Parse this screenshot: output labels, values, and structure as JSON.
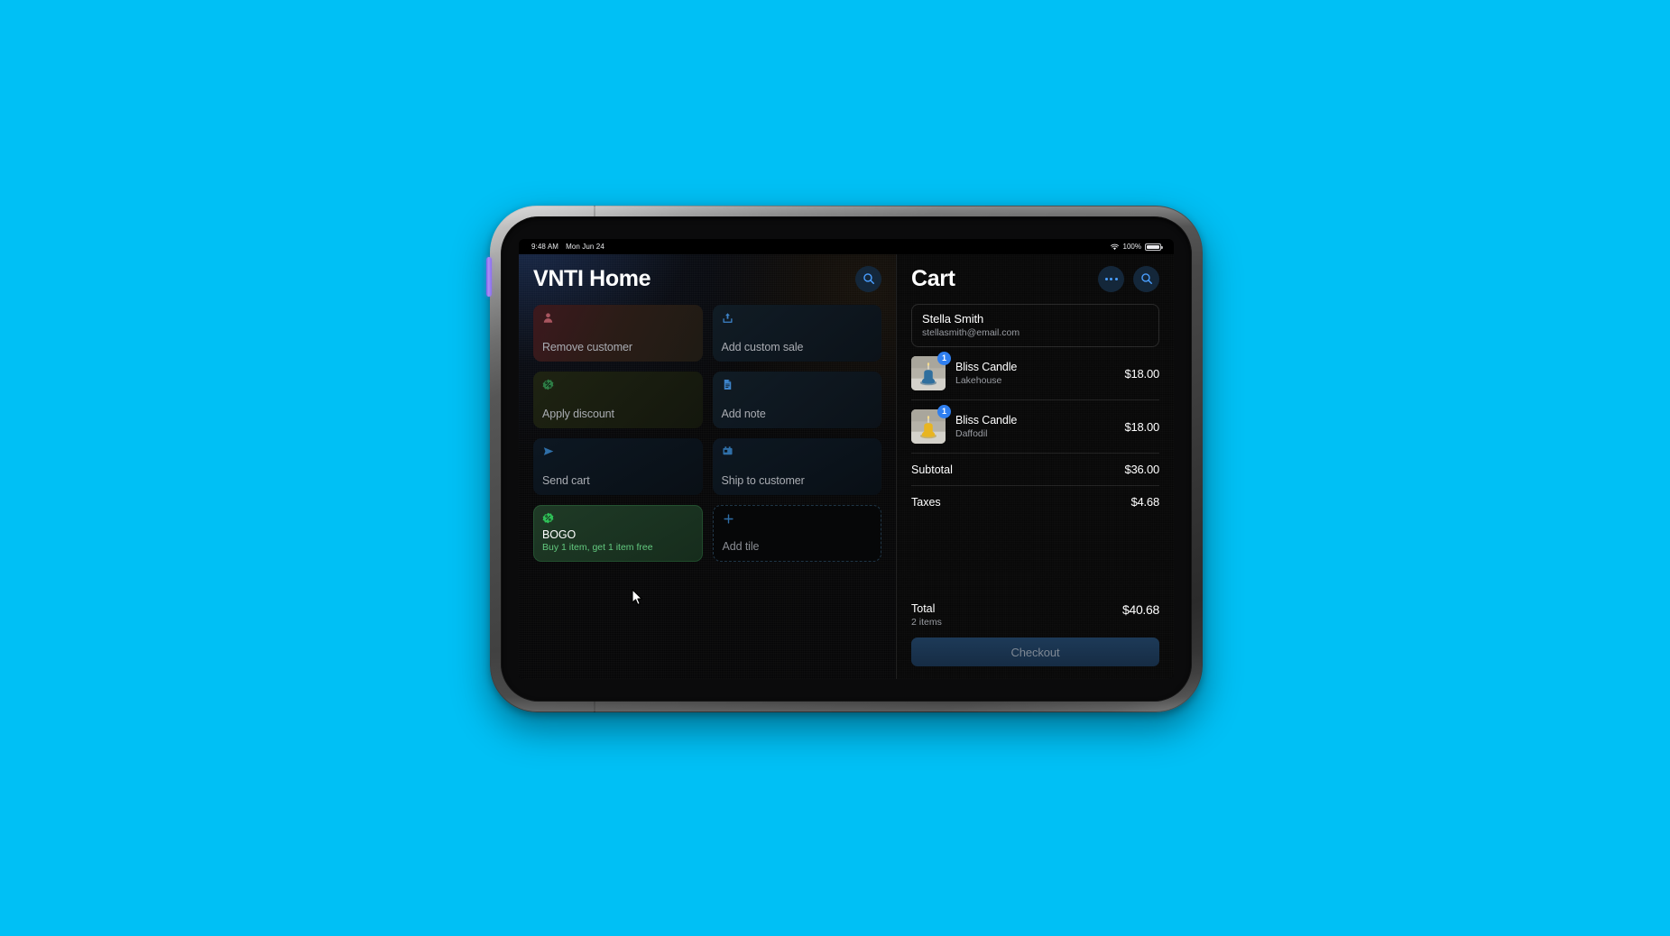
{
  "background": {
    "color": "#00c0f5"
  },
  "status_bar": {
    "time": "9:48 AM",
    "date": "Mon Jun 24",
    "battery_percent": "100%",
    "wifi_icon": "wifi-icon",
    "battery_icon": "battery-full-icon"
  },
  "left_panel": {
    "title": "VNTI Home",
    "search_icon": "search-icon",
    "tiles": [
      {
        "label": "Remove customer",
        "icon": "person-icon",
        "variant": "red",
        "sub": null
      },
      {
        "label": "Add custom sale",
        "icon": "upload-icon",
        "variant": "blue",
        "sub": null
      },
      {
        "label": "Apply discount",
        "icon": "discount-tag-icon",
        "variant": "olive",
        "sub": null
      },
      {
        "label": "Add note",
        "icon": "note-icon",
        "variant": "blue",
        "sub": null
      },
      {
        "label": "Send cart",
        "icon": "send-paper-plane-icon",
        "variant": "darkblue",
        "sub": null
      },
      {
        "label": "Ship to customer",
        "icon": "shipping-box-icon",
        "variant": "darkblue",
        "sub": null
      },
      {
        "label": "BOGO",
        "icon": "discount-tag-icon",
        "variant": "green-active",
        "sub": "Buy 1 item, get 1 item free"
      },
      {
        "label": "Add tile",
        "icon": "plus-icon",
        "variant": "add",
        "sub": null
      }
    ]
  },
  "cart": {
    "title": "Cart",
    "more_icon": "ellipsis-icon",
    "search_icon": "search-icon",
    "customer": {
      "name": "Stella Smith",
      "email": "stellasmith@email.com"
    },
    "line_items": [
      {
        "title": "Bliss Candle",
        "variant": "Lakehouse",
        "price": "$18.00",
        "qty": "1",
        "thumb_color": "#2f6f9e"
      },
      {
        "title": "Bliss Candle",
        "variant": "Daffodil",
        "price": "$18.00",
        "qty": "1",
        "thumb_color": "#e8b521"
      }
    ],
    "subtotal_label": "Subtotal",
    "subtotal_value": "$36.00",
    "taxes_label": "Taxes",
    "taxes_value": "$4.68",
    "total_label": "Total",
    "total_count": "2 items",
    "total_value": "$40.68",
    "checkout_label": "Checkout"
  },
  "colors": {
    "accent_blue": "#2f7ff0",
    "icon_blue": "#4a9eff",
    "green": "#63c97f",
    "checkout_bg": "#1d3a58",
    "screen_bg": "#050506"
  }
}
